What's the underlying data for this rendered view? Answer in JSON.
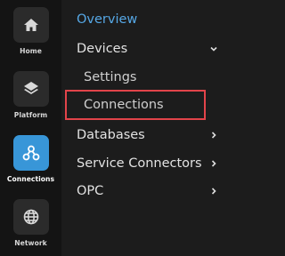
{
  "rail": {
    "items": [
      {
        "label": "Home",
        "icon": "home-icon",
        "active": false
      },
      {
        "label": "Platform",
        "icon": "layers-icon",
        "active": false
      },
      {
        "label": "Connections",
        "icon": "connections-icon",
        "active": true
      },
      {
        "label": "Network",
        "icon": "globe-icon",
        "active": false
      }
    ]
  },
  "nav": {
    "overview": "Overview",
    "devices": "Devices",
    "settings": "Settings",
    "connections": "Connections",
    "databases": "Databases",
    "service_connectors": "Service Connectors",
    "opc": "OPC"
  },
  "colors": {
    "accent": "#3896d8",
    "active_link": "#56a8e6",
    "highlight_border": "#e2444a",
    "rail_bg": "#141414",
    "nav_bg": "#1c1c1c"
  }
}
